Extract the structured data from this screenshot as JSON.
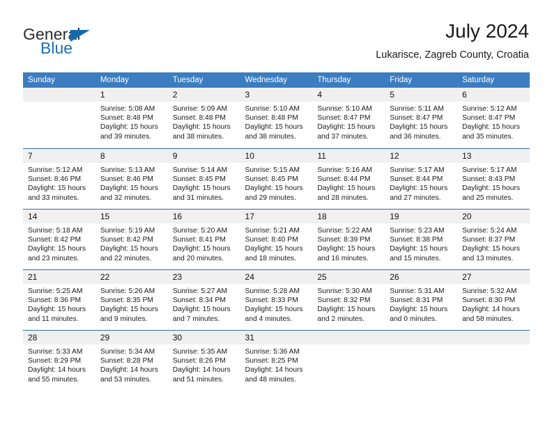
{
  "brand": {
    "name_part1": "General",
    "name_part2": "Blue",
    "accent_color": "#1569b0"
  },
  "header": {
    "title": "July 2024",
    "subtitle": "Lukarisce, Zagreb County, Croatia",
    "header_bg_color": "#3b7dc0",
    "daynum_bg_color": "#f0f0f0"
  },
  "calendar": {
    "weekday_headers": [
      "Sunday",
      "Monday",
      "Tuesday",
      "Wednesday",
      "Thursday",
      "Friday",
      "Saturday"
    ],
    "weeks": [
      [
        {
          "day": "",
          "sunrise": "",
          "sunset": "",
          "daylight_line1": "",
          "daylight_line2": "",
          "blank": true
        },
        {
          "day": "1",
          "sunrise": "Sunrise: 5:08 AM",
          "sunset": "Sunset: 8:48 PM",
          "daylight_line1": "Daylight: 15 hours",
          "daylight_line2": "and 39 minutes."
        },
        {
          "day": "2",
          "sunrise": "Sunrise: 5:09 AM",
          "sunset": "Sunset: 8:48 PM",
          "daylight_line1": "Daylight: 15 hours",
          "daylight_line2": "and 38 minutes."
        },
        {
          "day": "3",
          "sunrise": "Sunrise: 5:10 AM",
          "sunset": "Sunset: 8:48 PM",
          "daylight_line1": "Daylight: 15 hours",
          "daylight_line2": "and 38 minutes."
        },
        {
          "day": "4",
          "sunrise": "Sunrise: 5:10 AM",
          "sunset": "Sunset: 8:47 PM",
          "daylight_line1": "Daylight: 15 hours",
          "daylight_line2": "and 37 minutes."
        },
        {
          "day": "5",
          "sunrise": "Sunrise: 5:11 AM",
          "sunset": "Sunset: 8:47 PM",
          "daylight_line1": "Daylight: 15 hours",
          "daylight_line2": "and 36 minutes."
        },
        {
          "day": "6",
          "sunrise": "Sunrise: 5:12 AM",
          "sunset": "Sunset: 8:47 PM",
          "daylight_line1": "Daylight: 15 hours",
          "daylight_line2": "and 35 minutes."
        }
      ],
      [
        {
          "day": "7",
          "sunrise": "Sunrise: 5:12 AM",
          "sunset": "Sunset: 8:46 PM",
          "daylight_line1": "Daylight: 15 hours",
          "daylight_line2": "and 33 minutes."
        },
        {
          "day": "8",
          "sunrise": "Sunrise: 5:13 AM",
          "sunset": "Sunset: 8:46 PM",
          "daylight_line1": "Daylight: 15 hours",
          "daylight_line2": "and 32 minutes."
        },
        {
          "day": "9",
          "sunrise": "Sunrise: 5:14 AM",
          "sunset": "Sunset: 8:45 PM",
          "daylight_line1": "Daylight: 15 hours",
          "daylight_line2": "and 31 minutes."
        },
        {
          "day": "10",
          "sunrise": "Sunrise: 5:15 AM",
          "sunset": "Sunset: 8:45 PM",
          "daylight_line1": "Daylight: 15 hours",
          "daylight_line2": "and 29 minutes."
        },
        {
          "day": "11",
          "sunrise": "Sunrise: 5:16 AM",
          "sunset": "Sunset: 8:44 PM",
          "daylight_line1": "Daylight: 15 hours",
          "daylight_line2": "and 28 minutes."
        },
        {
          "day": "12",
          "sunrise": "Sunrise: 5:17 AM",
          "sunset": "Sunset: 8:44 PM",
          "daylight_line1": "Daylight: 15 hours",
          "daylight_line2": "and 27 minutes."
        },
        {
          "day": "13",
          "sunrise": "Sunrise: 5:17 AM",
          "sunset": "Sunset: 8:43 PM",
          "daylight_line1": "Daylight: 15 hours",
          "daylight_line2": "and 25 minutes."
        }
      ],
      [
        {
          "day": "14",
          "sunrise": "Sunrise: 5:18 AM",
          "sunset": "Sunset: 8:42 PM",
          "daylight_line1": "Daylight: 15 hours",
          "daylight_line2": "and 23 minutes."
        },
        {
          "day": "15",
          "sunrise": "Sunrise: 5:19 AM",
          "sunset": "Sunset: 8:42 PM",
          "daylight_line1": "Daylight: 15 hours",
          "daylight_line2": "and 22 minutes."
        },
        {
          "day": "16",
          "sunrise": "Sunrise: 5:20 AM",
          "sunset": "Sunset: 8:41 PM",
          "daylight_line1": "Daylight: 15 hours",
          "daylight_line2": "and 20 minutes."
        },
        {
          "day": "17",
          "sunrise": "Sunrise: 5:21 AM",
          "sunset": "Sunset: 8:40 PM",
          "daylight_line1": "Daylight: 15 hours",
          "daylight_line2": "and 18 minutes."
        },
        {
          "day": "18",
          "sunrise": "Sunrise: 5:22 AM",
          "sunset": "Sunset: 8:39 PM",
          "daylight_line1": "Daylight: 15 hours",
          "daylight_line2": "and 16 minutes."
        },
        {
          "day": "19",
          "sunrise": "Sunrise: 5:23 AM",
          "sunset": "Sunset: 8:38 PM",
          "daylight_line1": "Daylight: 15 hours",
          "daylight_line2": "and 15 minutes."
        },
        {
          "day": "20",
          "sunrise": "Sunrise: 5:24 AM",
          "sunset": "Sunset: 8:37 PM",
          "daylight_line1": "Daylight: 15 hours",
          "daylight_line2": "and 13 minutes."
        }
      ],
      [
        {
          "day": "21",
          "sunrise": "Sunrise: 5:25 AM",
          "sunset": "Sunset: 8:36 PM",
          "daylight_line1": "Daylight: 15 hours",
          "daylight_line2": "and 11 minutes."
        },
        {
          "day": "22",
          "sunrise": "Sunrise: 5:26 AM",
          "sunset": "Sunset: 8:35 PM",
          "daylight_line1": "Daylight: 15 hours",
          "daylight_line2": "and 9 minutes."
        },
        {
          "day": "23",
          "sunrise": "Sunrise: 5:27 AM",
          "sunset": "Sunset: 8:34 PM",
          "daylight_line1": "Daylight: 15 hours",
          "daylight_line2": "and 7 minutes."
        },
        {
          "day": "24",
          "sunrise": "Sunrise: 5:28 AM",
          "sunset": "Sunset: 8:33 PM",
          "daylight_line1": "Daylight: 15 hours",
          "daylight_line2": "and 4 minutes."
        },
        {
          "day": "25",
          "sunrise": "Sunrise: 5:30 AM",
          "sunset": "Sunset: 8:32 PM",
          "daylight_line1": "Daylight: 15 hours",
          "daylight_line2": "and 2 minutes."
        },
        {
          "day": "26",
          "sunrise": "Sunrise: 5:31 AM",
          "sunset": "Sunset: 8:31 PM",
          "daylight_line1": "Daylight: 15 hours",
          "daylight_line2": "and 0 minutes."
        },
        {
          "day": "27",
          "sunrise": "Sunrise: 5:32 AM",
          "sunset": "Sunset: 8:30 PM",
          "daylight_line1": "Daylight: 14 hours",
          "daylight_line2": "and 58 minutes."
        }
      ],
      [
        {
          "day": "28",
          "sunrise": "Sunrise: 5:33 AM",
          "sunset": "Sunset: 8:29 PM",
          "daylight_line1": "Daylight: 14 hours",
          "daylight_line2": "and 55 minutes."
        },
        {
          "day": "29",
          "sunrise": "Sunrise: 5:34 AM",
          "sunset": "Sunset: 8:28 PM",
          "daylight_line1": "Daylight: 14 hours",
          "daylight_line2": "and 53 minutes."
        },
        {
          "day": "30",
          "sunrise": "Sunrise: 5:35 AM",
          "sunset": "Sunset: 8:26 PM",
          "daylight_line1": "Daylight: 14 hours",
          "daylight_line2": "and 51 minutes."
        },
        {
          "day": "31",
          "sunrise": "Sunrise: 5:36 AM",
          "sunset": "Sunset: 8:25 PM",
          "daylight_line1": "Daylight: 14 hours",
          "daylight_line2": "and 48 minutes."
        },
        {
          "day": "",
          "sunrise": "",
          "sunset": "",
          "daylight_line1": "",
          "daylight_line2": "",
          "blank": true
        },
        {
          "day": "",
          "sunrise": "",
          "sunset": "",
          "daylight_line1": "",
          "daylight_line2": "",
          "blank": true
        },
        {
          "day": "",
          "sunrise": "",
          "sunset": "",
          "daylight_line1": "",
          "daylight_line2": "",
          "blank": true
        }
      ]
    ]
  }
}
